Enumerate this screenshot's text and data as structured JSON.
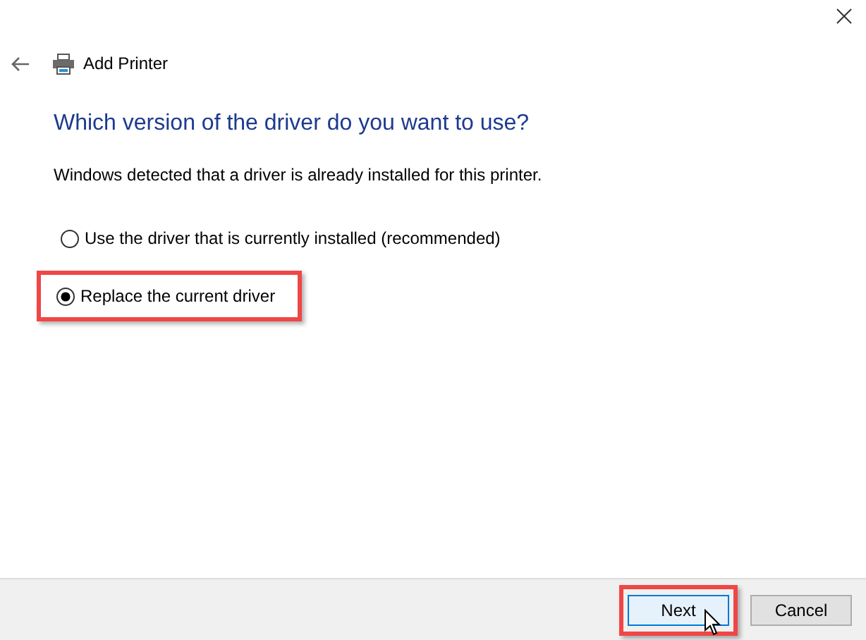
{
  "window": {
    "title": "Add Printer"
  },
  "heading": "Which version of the driver do you want to use?",
  "description": "Windows detected that a driver is already installed for this printer.",
  "options": [
    {
      "label": "Use the driver that is currently installed (recommended)",
      "selected": false,
      "highlighted": false
    },
    {
      "label": "Replace the current driver",
      "selected": true,
      "highlighted": true
    }
  ],
  "buttons": [
    {
      "label": "Next",
      "default": true,
      "highlighted": true
    },
    {
      "label": "Cancel",
      "default": false,
      "highlighted": false
    }
  ]
}
